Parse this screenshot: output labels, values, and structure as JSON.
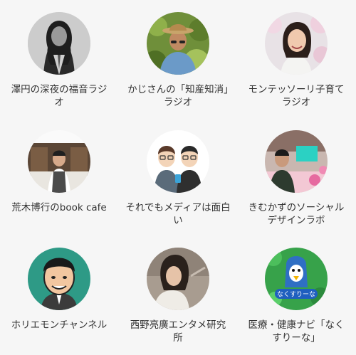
{
  "podcasts": [
    {
      "title": "澤円の深夜の福音ラジオ",
      "avatar_icon": "man-long-hair-photo-icon"
    },
    {
      "title": "かじさんの「知産知消」ラジオ",
      "avatar_icon": "man-straw-hat-photo-icon"
    },
    {
      "title": "モンテッソーリ子育てラジオ",
      "avatar_icon": "woman-smiling-photo-icon"
    },
    {
      "title": "荒木博行のbook cafe",
      "avatar_icon": "man-apron-cafe-photo-icon"
    },
    {
      "title": "それでもメディアは面白い",
      "avatar_icon": "two-men-illustration-icon"
    },
    {
      "title": "きむかずのソーシャルデザインラボ",
      "avatar_icon": "man-in-studio-photo-icon"
    },
    {
      "title": "ホリエモンチャンネル",
      "avatar_icon": "man-caricature-icon"
    },
    {
      "title": "西野亮廣エンタメ研究所",
      "avatar_icon": "man-portrait-photo-icon"
    },
    {
      "title": "医療・健康ナビ「なくすりーな」",
      "avatar_icon": "penguin-mascot-icon"
    }
  ],
  "mascot_text": "なくすりーな"
}
